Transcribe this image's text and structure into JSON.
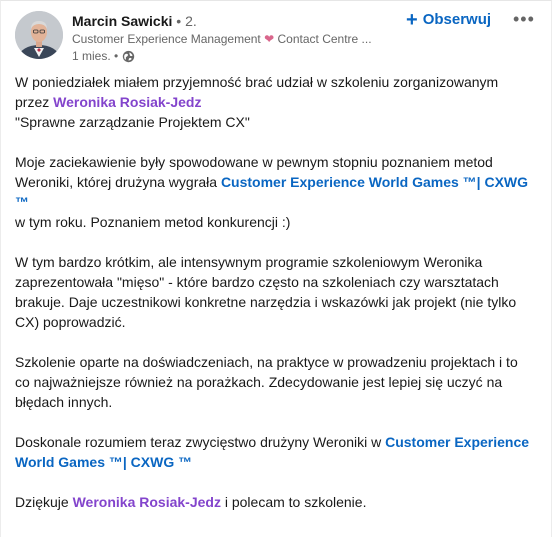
{
  "post": {
    "author": {
      "name": "Marcin Sawicki",
      "degree": "• 2.",
      "headline_part1": "Customer Experience Management",
      "headline_heart": "❤",
      "headline_part2": "Contact Centre ...",
      "time": "1 mies. •",
      "visibility_icon": "globe-icon"
    },
    "actions": {
      "follow_plus": "+",
      "follow_label": "Obserwuj",
      "more_label": "•••"
    },
    "paragraphs": {
      "p1": {
        "line1": "W poniedziałek miałem przyjemność brać udział w szkoleniu zorganizowanym przez",
        "mention": "Weronika Rosiak-Jedz",
        "line2": "\"Sprawne zarządzanie Projektem CX\""
      },
      "p2": {
        "text1": "Moje zaciekawienie były spowodowane w pewnym stopniu poznaniem metod Weroniki, której drużyna wygrała",
        "link": "Customer Experience World Games ™| CXWG ™",
        "text2": "w tym roku. Poznaniem metod konkurencji :)"
      },
      "p3": {
        "text": "W tym bardzo krótkim, ale intensywnym programie szkoleniowym Weronika zaprezentowała \"mięso\" - które bardzo często na szkoleniach czy warsztatach brakuje. Daje uczestnikowi konkretne narzędzia i wskazówki jak projekt (nie tylko CX) poprowadzić."
      },
      "p4": {
        "text": "Szkolenie oparte na doświadczeniach, na praktyce w prowadzeniu projektach i to co najważniejsze również na porażkach. Zdecydowanie jest lepiej się uczyć na błędach innych."
      },
      "p5": {
        "text": "Doskonale rozumiem teraz zwycięstwo drużyny Weroniki w",
        "link": "Customer Experience World Games ™| CXWG ™"
      },
      "p6": {
        "text1": "Dziękuje",
        "mention": "Weronika Rosiak-Jedz",
        "text2": "i polecam to szkolenie."
      }
    },
    "colors": {
      "mention": "#8344cc",
      "link": "#0a66c2",
      "text": "#191919",
      "secondary": "#666666"
    }
  }
}
